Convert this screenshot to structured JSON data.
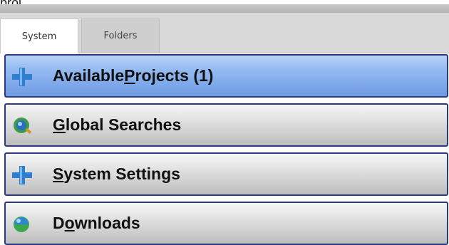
{
  "header": {
    "top_label": "proj"
  },
  "tabs": [
    {
      "label": "System",
      "active": true
    },
    {
      "label": "Folders",
      "active": false
    }
  ],
  "panels": [
    {
      "id": "available-projects",
      "label_before": "Available ",
      "label_underlined": "P",
      "label_after": "rojects (1)",
      "icon": "plus-icon",
      "active": true
    },
    {
      "id": "global-searches",
      "label_before": "",
      "label_underlined": "G",
      "label_after": "lobal Searches",
      "icon": "globe-search-icon",
      "active": false
    },
    {
      "id": "system-settings",
      "label_before": "",
      "label_underlined": "S",
      "label_after": "ystem Settings",
      "icon": "plus-icon",
      "active": false
    },
    {
      "id": "downloads",
      "label_before": "D",
      "label_underlined": "o",
      "label_after": "wnloads",
      "icon": "download-globe-icon",
      "active": false
    }
  ],
  "colors": {
    "panel_border": "#2b3a82",
    "active_panel": "#7fa9ea",
    "plus_icon": "#3a86d4"
  }
}
